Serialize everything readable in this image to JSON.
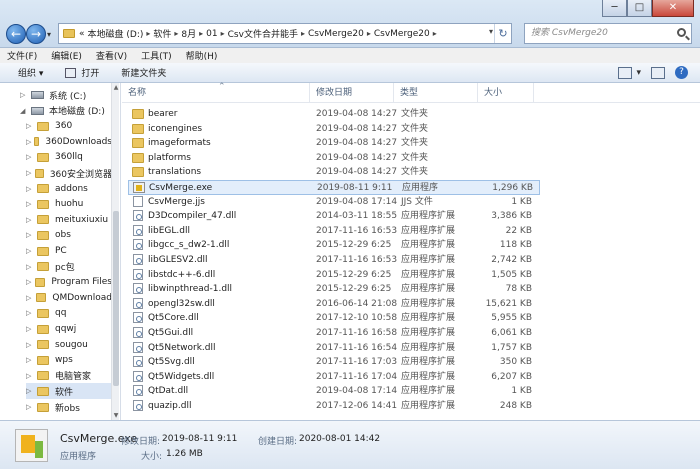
{
  "window": {
    "minimize_label": "─",
    "maximize_label": "□",
    "close_label": "✕"
  },
  "nav": {
    "back_label": "←",
    "forward_label": "→",
    "history_label": "▾",
    "address": {
      "prefix": "«",
      "crumbs": [
        "本地磁盘 (D:)",
        "软件",
        "8月",
        "01",
        "Csv文件合并能手",
        "CsvMerge20",
        "CsvMerge20"
      ],
      "separator": "▸",
      "dropdown": "▾",
      "refresh": "↻"
    },
    "search_placeholder": "搜索 CsvMerge20"
  },
  "menu": [
    "文件(F)",
    "编辑(E)",
    "查看(V)",
    "工具(T)",
    "帮助(H)"
  ],
  "commands": {
    "organize": "组织 ▾",
    "open": "打开",
    "new_folder": "新建文件夹",
    "view_dd": "▾",
    "help": "?"
  },
  "sidebar": {
    "items": [
      {
        "label": "系统 (C:)",
        "kind": "drive",
        "indent": 1,
        "expander": "▷",
        "selected": false
      },
      {
        "label": "本地磁盘 (D:)",
        "kind": "drive",
        "indent": 1,
        "expander": "◢",
        "selected": false
      },
      {
        "label": "360",
        "kind": "folder",
        "indent": 2,
        "expander": "▷",
        "selected": false
      },
      {
        "label": "360Downloads",
        "kind": "folder",
        "indent": 2,
        "expander": "▷",
        "selected": false
      },
      {
        "label": "360llq",
        "kind": "folder",
        "indent": 2,
        "expander": "▷",
        "selected": false
      },
      {
        "label": "360安全浏览器",
        "kind": "folder",
        "indent": 2,
        "expander": "▷",
        "selected": false
      },
      {
        "label": "addons",
        "kind": "folder",
        "indent": 2,
        "expander": "▷",
        "selected": false
      },
      {
        "label": "huohu",
        "kind": "folder",
        "indent": 2,
        "expander": "▷",
        "selected": false
      },
      {
        "label": "meituxiuxiu",
        "kind": "folder",
        "indent": 2,
        "expander": "▷",
        "selected": false
      },
      {
        "label": "obs",
        "kind": "folder",
        "indent": 2,
        "expander": "▷",
        "selected": false
      },
      {
        "label": "PC",
        "kind": "folder",
        "indent": 2,
        "expander": "▷",
        "selected": false
      },
      {
        "label": "pc包",
        "kind": "folder",
        "indent": 2,
        "expander": "▷",
        "selected": false
      },
      {
        "label": "Program Files",
        "kind": "folder",
        "indent": 2,
        "expander": "▷",
        "selected": false
      },
      {
        "label": "QMDownload",
        "kind": "folder",
        "indent": 2,
        "expander": "▷",
        "selected": false
      },
      {
        "label": "qq",
        "kind": "folder",
        "indent": 2,
        "expander": "▷",
        "selected": false
      },
      {
        "label": "qqwj",
        "kind": "folder",
        "indent": 2,
        "expander": "▷",
        "selected": false
      },
      {
        "label": "sougou",
        "kind": "folder",
        "indent": 2,
        "expander": "▷",
        "selected": false
      },
      {
        "label": "wps",
        "kind": "folder",
        "indent": 2,
        "expander": "▷",
        "selected": false
      },
      {
        "label": "电脑管家",
        "kind": "folder",
        "indent": 2,
        "expander": "▷",
        "selected": false
      },
      {
        "label": "软件",
        "kind": "folder",
        "indent": 2,
        "expander": "▷",
        "selected": true
      },
      {
        "label": "新obs",
        "kind": "folder",
        "indent": 2,
        "expander": "▷",
        "selected": false
      }
    ],
    "scroll_up": "▲",
    "scroll_down": "▼"
  },
  "columns": [
    "名称",
    "修改日期",
    "类型",
    "大小"
  ],
  "sort_arrow": "⌃",
  "files": [
    {
      "name": "bearer",
      "date": "2019-04-08 14:27",
      "type": "文件夹",
      "size": "",
      "icon": "folder-icon"
    },
    {
      "name": "iconengines",
      "date": "2019-04-08 14:27",
      "type": "文件夹",
      "size": "",
      "icon": "folder-icon"
    },
    {
      "name": "imageformats",
      "date": "2019-04-08 14:27",
      "type": "文件夹",
      "size": "",
      "icon": "folder-icon"
    },
    {
      "name": "platforms",
      "date": "2019-04-08 14:27",
      "type": "文件夹",
      "size": "",
      "icon": "folder-icon"
    },
    {
      "name": "translations",
      "date": "2019-04-08 14:27",
      "type": "文件夹",
      "size": "",
      "icon": "folder-icon"
    },
    {
      "name": "CsvMerge.exe",
      "date": "2019-08-11 9:11",
      "type": "应用程序",
      "size": "1,296 KB",
      "icon": "exe-icon",
      "selected": true
    },
    {
      "name": "CsvMerge.jjs",
      "date": "2019-04-08 17:14",
      "type": "JJS 文件",
      "size": "1 KB",
      "icon": "file-icon"
    },
    {
      "name": "D3Dcompiler_47.dll",
      "date": "2014-03-11 18:55",
      "type": "应用程序扩展",
      "size": "3,386 KB",
      "icon": "dll-icon"
    },
    {
      "name": "libEGL.dll",
      "date": "2017-11-16 16:53",
      "type": "应用程序扩展",
      "size": "22 KB",
      "icon": "dll-icon"
    },
    {
      "name": "libgcc_s_dw2-1.dll",
      "date": "2015-12-29 6:25",
      "type": "应用程序扩展",
      "size": "118 KB",
      "icon": "dll-icon"
    },
    {
      "name": "libGLESV2.dll",
      "date": "2017-11-16 16:53",
      "type": "应用程序扩展",
      "size": "2,742 KB",
      "icon": "dll-icon"
    },
    {
      "name": "libstdc++-6.dll",
      "date": "2015-12-29 6:25",
      "type": "应用程序扩展",
      "size": "1,505 KB",
      "icon": "dll-icon"
    },
    {
      "name": "libwinpthread-1.dll",
      "date": "2015-12-29 6:25",
      "type": "应用程序扩展",
      "size": "78 KB",
      "icon": "dll-icon"
    },
    {
      "name": "opengl32sw.dll",
      "date": "2016-06-14 21:08",
      "type": "应用程序扩展",
      "size": "15,621 KB",
      "icon": "dll-icon"
    },
    {
      "name": "Qt5Core.dll",
      "date": "2017-12-10 10:58",
      "type": "应用程序扩展",
      "size": "5,955 KB",
      "icon": "dll-icon"
    },
    {
      "name": "Qt5Gui.dll",
      "date": "2017-11-16 16:58",
      "type": "应用程序扩展",
      "size": "6,061 KB",
      "icon": "dll-icon"
    },
    {
      "name": "Qt5Network.dll",
      "date": "2017-11-16 16:54",
      "type": "应用程序扩展",
      "size": "1,757 KB",
      "icon": "dll-icon"
    },
    {
      "name": "Qt5Svg.dll",
      "date": "2017-11-16 17:03",
      "type": "应用程序扩展",
      "size": "350 KB",
      "icon": "dll-icon"
    },
    {
      "name": "Qt5Widgets.dll",
      "date": "2017-11-16 17:04",
      "type": "应用程序扩展",
      "size": "6,207 KB",
      "icon": "dll-icon"
    },
    {
      "name": "QtDat.dll",
      "date": "2019-04-08 17:14",
      "type": "应用程序扩展",
      "size": "1 KB",
      "icon": "dll-icon"
    },
    {
      "name": "quazip.dll",
      "date": "2017-12-06 14:41",
      "type": "应用程序扩展",
      "size": "248 KB",
      "icon": "dll-icon"
    }
  ],
  "details": {
    "filename": "CsvMerge.exe",
    "type": "应用程序",
    "modified_label": "修改日期:",
    "modified_value": "2019-08-11 9:11",
    "created_label": "创建日期:",
    "created_value": "2020-08-01 14:42",
    "size_label": "大小:",
    "size_value": "1.26 MB"
  }
}
